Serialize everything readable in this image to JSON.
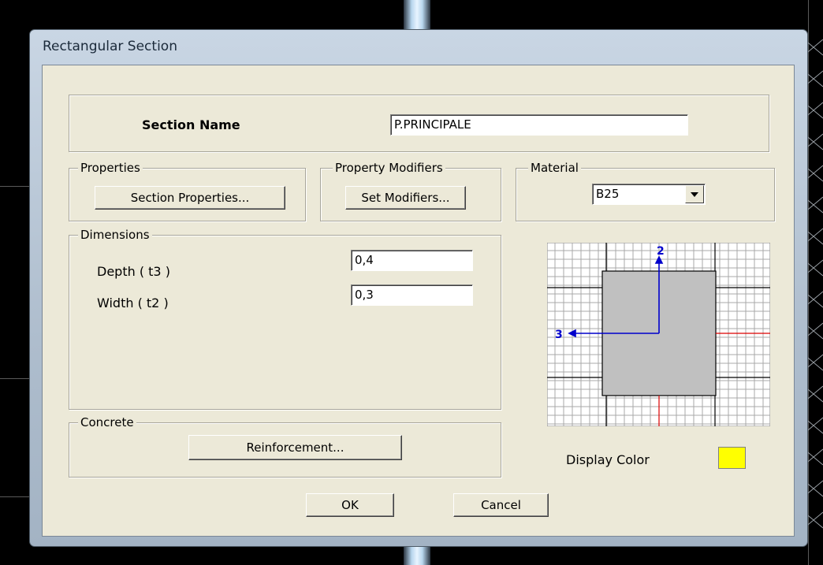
{
  "dialog": {
    "title": "Rectangular Section",
    "section_name": {
      "label": "Section Name",
      "value": "P.PRINCIPALE"
    },
    "properties": {
      "group_label": "Properties",
      "button_label": "Section Properties..."
    },
    "property_modifiers": {
      "group_label": "Property Modifiers",
      "button_label": "Set Modifiers..."
    },
    "material": {
      "group_label": "Material",
      "selected": "B25"
    },
    "dimensions": {
      "group_label": "Dimensions",
      "depth": {
        "label": "Depth  ( t3 )",
        "value": "0,4"
      },
      "width": {
        "label": "Width  ( t2 )",
        "value": "0,3"
      }
    },
    "preview": {
      "axis_2_label": "2",
      "axis_3_label": "3"
    },
    "concrete": {
      "group_label": "Concrete",
      "button_label": "Reinforcement..."
    },
    "display_color": {
      "label": "Display Color",
      "color": "#ffff00"
    },
    "ok_label": "OK",
    "cancel_label": "Cancel"
  },
  "colors": {
    "axis_blue": "#0000cc",
    "axis_red": "#dd0000",
    "section_fill": "#c0c0c0"
  }
}
